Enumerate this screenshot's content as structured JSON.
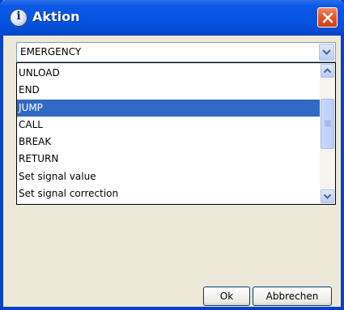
{
  "window": {
    "title": "Aktion"
  },
  "combo": {
    "value": "EMERGENCY"
  },
  "list": {
    "items": [
      {
        "label": "UNLOAD",
        "selected": false
      },
      {
        "label": "END",
        "selected": false
      },
      {
        "label": "JUMP",
        "selected": true
      },
      {
        "label": "CALL",
        "selected": false
      },
      {
        "label": "BREAK",
        "selected": false
      },
      {
        "label": "RETURN",
        "selected": false
      },
      {
        "label": "Set signal value",
        "selected": false
      },
      {
        "label": "Set signal correction",
        "selected": false
      }
    ]
  },
  "buttons": {
    "ok": "Ok",
    "cancel": "Abbrechen"
  },
  "icons": {
    "title": "info-icon",
    "close": "close-icon",
    "dropdown": "chevron-down-icon",
    "scroll_up": "chevron-up-icon",
    "scroll_down": "chevron-down-icon"
  },
  "colors": {
    "titlebar": "#0554e2",
    "selection": "#316ac5",
    "close": "#e0592e"
  }
}
